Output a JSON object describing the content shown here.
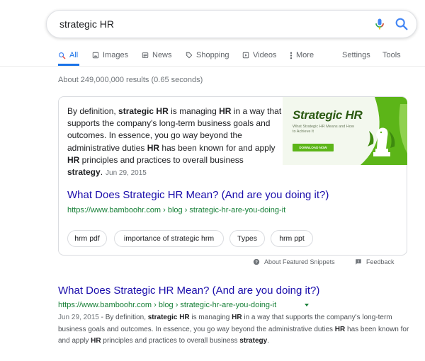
{
  "search": {
    "query": "strategic HR"
  },
  "tabs": [
    {
      "label": "All",
      "icon": "search-icon"
    },
    {
      "label": "Images",
      "icon": "image-icon"
    },
    {
      "label": "News",
      "icon": "news-icon"
    },
    {
      "label": "Shopping",
      "icon": "tag-icon"
    },
    {
      "label": "Videos",
      "icon": "play-icon"
    },
    {
      "label": "More",
      "icon": "more-dots-icon"
    }
  ],
  "tools": {
    "settings": "Settings",
    "tools": "Tools"
  },
  "result_count": "About 249,000,000 results (0.65 seconds)",
  "featured_snippet": {
    "text_parts": [
      "By definition, ",
      "strategic HR",
      " is managing ",
      "HR",
      " in a way that supports the company's long-term business goals and outcomes. In essence, you go way beyond the administrative duties ",
      "HR",
      " has been known for and apply ",
      "HR",
      " principles and practices to overall business ",
      "strategy",
      "."
    ],
    "date": "Jun 29, 2015",
    "image": {
      "title": "Strategic HR",
      "subtitle": "What Strategic HR Means and How to Achieve It",
      "button": "DOWNLOAD NOW"
    },
    "link_title": "What Does Strategic HR Mean? (And are you doing it?)",
    "url": "https://www.bamboohr.com › blog › strategic-hr-are-you-doing-it",
    "chips": [
      "hrm pdf",
      "importance of strategic hrm",
      "Types",
      "hrm ppt"
    ]
  },
  "snippet_footer": {
    "about": "About Featured Snippets",
    "feedback": "Feedback"
  },
  "result2": {
    "title": "What Does Strategic HR Mean? (And are you doing it?)",
    "url": "https://www.bamboohr.com › blog › strategic-hr-are-you-doing-it",
    "date": "Jun 29, 2015",
    "desc_parts": [
      " - By definition, ",
      "strategic HR",
      " is managing ",
      "HR",
      " in a way that supports the company's long-term business goals and outcomes. In essence, you go way beyond the administrative duties ",
      "HR",
      " has been known for and apply ",
      "HR",
      " principles and practices to overall business ",
      "strategy",
      "."
    ]
  },
  "colors": {
    "accent": "#1a73e8",
    "link": "#1a0dab",
    "url": "#188038",
    "brand_green": "#5cb518"
  }
}
